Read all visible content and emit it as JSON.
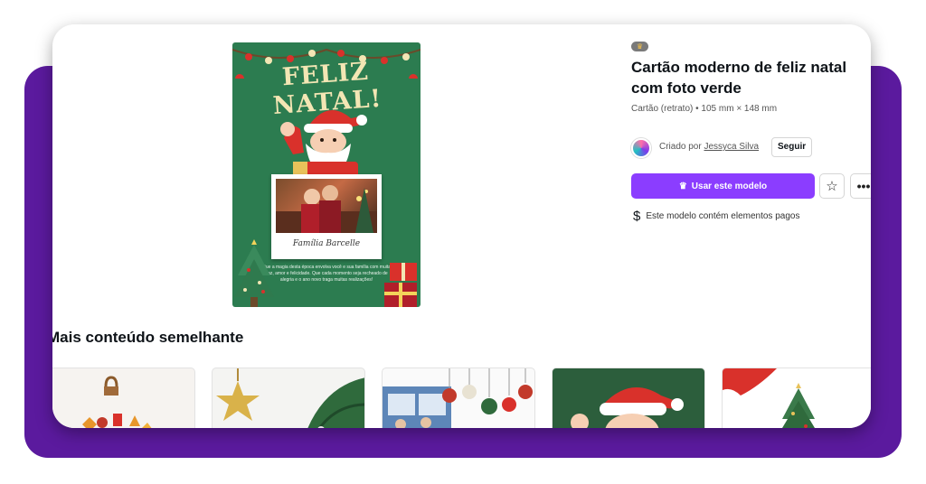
{
  "template": {
    "card": {
      "heading": "FELIZ NATAL!",
      "photo_caption": "Família Barcelle",
      "message": "Que a magia desta época envolva você e sua família com muita paz, amor e felicidade. Que cada momento seja recheado de alegria e o ano novo traga muitas realizações!"
    },
    "badge_icon": "crown-icon",
    "title": "Cartão moderno de feliz natal com foto verde",
    "subtitle": "Cartão (retrato) • 105 mm × 148 mm",
    "creator_prefix": "Criado por",
    "creator_name": "Jessyca Silva",
    "follow_label": "Seguir",
    "use_button_label": "Usar este modelo",
    "paid_notice": "Este modelo contém elementos pagos"
  },
  "similar": {
    "heading": "Mais conteúdo semelhante",
    "thumbnails": [
      "ornament-thumbnail",
      "gold-star-thumbnail",
      "family-ornaments-thumbnail",
      "santa-green-thumbnail",
      "christmas-tree-thumbnail"
    ]
  },
  "colors": {
    "accent": "#8b3dff",
    "frame": "#5b1a9e",
    "card_green": "#2c7c50"
  }
}
